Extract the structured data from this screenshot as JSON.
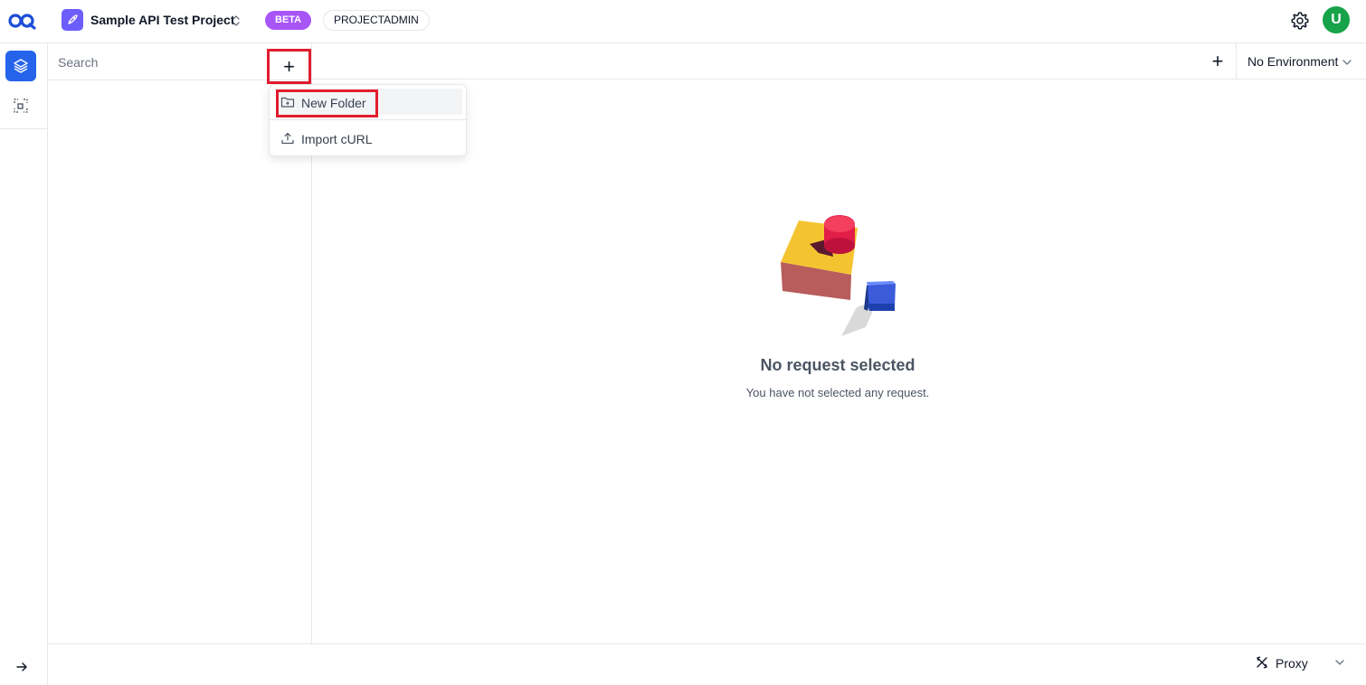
{
  "topbar": {
    "project_name": "Sample API Test Project",
    "beta_badge": "BETA",
    "role_badge": "PROJECTADMIN",
    "avatar_initial": "U"
  },
  "sidebar": {
    "search_placeholder": "Search",
    "add_button": "+"
  },
  "add_menu": {
    "items": [
      {
        "label": "New Folder",
        "icon": "folder-plus-icon",
        "highlighted": true
      },
      {
        "label": "Import cURL",
        "icon": "upload-icon",
        "highlighted": false
      }
    ]
  },
  "header": {
    "new_tab_button": "+",
    "environment_selected": "No Environment"
  },
  "empty_state": {
    "title": "No request selected",
    "subtitle": "You have not selected any request."
  },
  "footer": {
    "proxy_label": "Proxy"
  },
  "colors": {
    "accent": "#2563eb",
    "beta": "#a855f7",
    "avatar": "#16a34a",
    "annotation": "#e11d2e",
    "project_icon": "#6d5dfc"
  }
}
